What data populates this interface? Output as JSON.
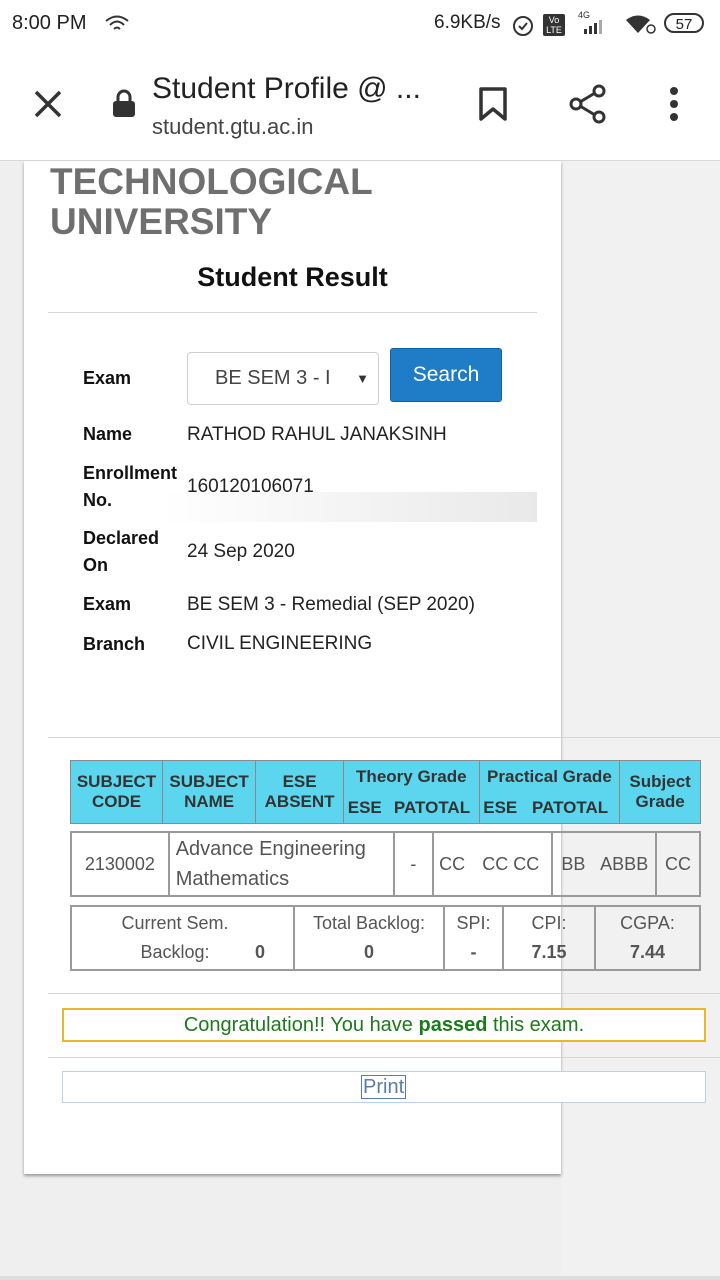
{
  "status_bar": {
    "time": "8:00 PM",
    "net_speed": "6.9KB/s",
    "battery": "57",
    "network": "4G",
    "volte": "Vo LTE"
  },
  "browser": {
    "title": "Student Profile @ ...",
    "url": "student.gtu.ac.in"
  },
  "page": {
    "university": "TECHNOLOGICAL UNIVERSITY",
    "heading": "Student Result",
    "form": {
      "exam_label": "Exam",
      "exam_selected": "BE SEM 3 - I",
      "search_label": "Search"
    },
    "details": [
      {
        "label": "Name",
        "value": "RATHOD RAHUL JANAKSINH"
      },
      {
        "label": "Enrollment No.",
        "value": "160120106071"
      },
      {
        "label": "Declared On",
        "value": "24 Sep 2020"
      },
      {
        "label": "Exam",
        "value": "BE SEM 3 - Remedial (SEP 2020)"
      },
      {
        "label": "Branch",
        "value": "CIVIL ENGINEERING"
      }
    ],
    "table_headers": {
      "subject_code": "SUBJECT CODE",
      "subject_name": "SUBJECT NAME",
      "ese_absent": "ESE ABSENT",
      "theory_grade": "Theory Grade",
      "practical_grade": "Practical Grade",
      "subject_grade": "Subject Grade",
      "ese": "ESE",
      "patotal": "PATOTAL"
    },
    "subjects": [
      {
        "code": "2130002",
        "name": "Advance Engineering Mathematics",
        "ese_absent": "-",
        "theory_ese": "CC",
        "theory_patotal": "CC CC",
        "practical_ese": "BB",
        "practical_patotal": "ABBB",
        "grade": "CC"
      }
    ],
    "summary": {
      "current_backlog_label": "Current Sem. Backlog:",
      "current_backlog": "0",
      "total_backlog_label": "Total Backlog:",
      "total_backlog": "0",
      "spi_label": "SPI:",
      "spi": "-",
      "cpi_label": "CPI:",
      "cpi": "7.15",
      "cgpa_label": "CGPA:",
      "cgpa": "7.44"
    },
    "congrats": {
      "before": "Congratulation!! You have ",
      "bold": "passed",
      "after": " this exam."
    },
    "print_label": "Print"
  },
  "colors": {
    "header_cyan": "#5bd6ee",
    "search_blue": "#1f7cc7",
    "congrats_green": "#1c7a1c",
    "congrats_border": "#e6b82e"
  }
}
